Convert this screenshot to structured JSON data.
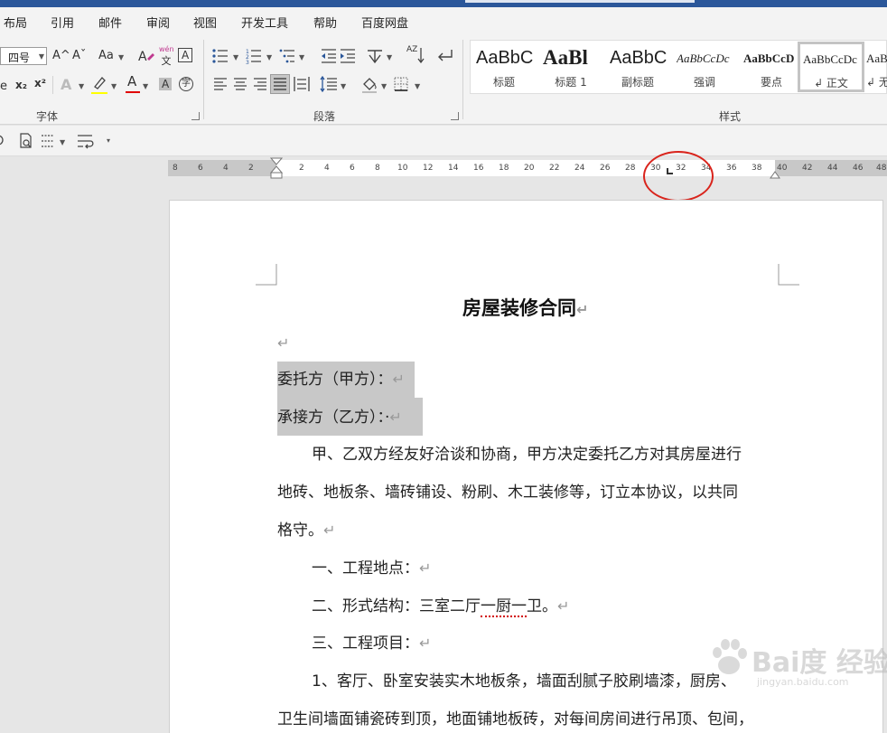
{
  "menu": [
    "布局",
    "引用",
    "邮件",
    "审阅",
    "视图",
    "开发工具",
    "帮助",
    "百度网盘"
  ],
  "ribbon": {
    "font_group": {
      "label": "字体",
      "font_size_value": "四号",
      "grow_font": "A^",
      "shrink_font": "Aˇ",
      "change_case": "Aa",
      "phonetic_top": "wén",
      "phonetic_bottom": "文",
      "char_border": "A",
      "subscript": "x₂",
      "superscript": "x²",
      "text_effects": "A",
      "font_color": "A",
      "char_shading": "A",
      "enclose_char": "字",
      "highlight_color": "#ffff00",
      "font_color_value": "#e00000"
    },
    "paragraph_group": {
      "label": "段落",
      "sort_label": "AZ"
    },
    "styles_group": {
      "label": "样式",
      "styles": [
        {
          "sample": "AaBbC",
          "name": "标题"
        },
        {
          "sample": "AaBl",
          "name": "标题 1"
        },
        {
          "sample": "AaBbC",
          "name": "副标题"
        },
        {
          "sample": "AaBbCcDc",
          "name": "强调"
        },
        {
          "sample": "AaBbCcD",
          "name": "要点"
        },
        {
          "sample": "AaBbCcDc",
          "name": "↲ 正文"
        },
        {
          "sample": "AaB",
          "name": "↲ 无"
        }
      ]
    }
  },
  "ruler": {
    "left_numbers": [
      "8",
      "6",
      "4",
      "2"
    ],
    "right_numbers": [
      "2",
      "4",
      "6",
      "8",
      "10",
      "12",
      "14",
      "16",
      "18",
      "20",
      "22",
      "24",
      "26",
      "28",
      "30",
      "32",
      "34",
      "36",
      "38",
      "40",
      "42",
      "44",
      "46",
      "48"
    ]
  },
  "document": {
    "title": "房屋装修合同",
    "paragraph_mark": "↵",
    "lines": {
      "party_a": "委托方（甲方）：",
      "party_b": "承接方（乙方）：·",
      "intro_1": "甲、乙双方经友好洽谈和协商，甲方决定委托乙方对其房屋进行",
      "intro_2": "地砖、地板条、墙砖铺设、粉刷、木工装修等，订立本协议，以共同",
      "intro_3": "格守。",
      "item1": "一、工程地点：",
      "item2_a": "二、形式结构：三室二厅",
      "item2_b": "一厨一",
      "item2_c": "卫。",
      "item3": "三、工程项目：",
      "detail_1": "1、客厅、卧室安装实木地板条，墙面刮腻子胶刷墙漆，厨房、",
      "detail_2": "卫生间墙面铺瓷砖到顶，地面铺地板砖，对每间房间进行吊顶、包间，"
    }
  },
  "watermark": {
    "text": "Bai度 经验",
    "sub": "jingyan.baidu.com"
  },
  "colors": {
    "accent": "#2b579a",
    "annotation": "#d9241c",
    "selection": "#c8c8c8"
  }
}
